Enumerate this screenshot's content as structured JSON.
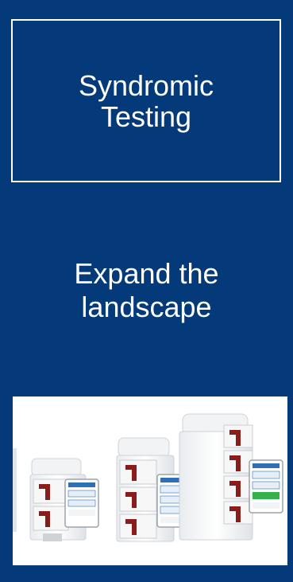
{
  "title_box": {
    "line1": "Syndromic",
    "line2": "Testing"
  },
  "tagline": {
    "line1": "Expand the",
    "line2": "landscape"
  },
  "image": {
    "alt": "Modular testing instruments with touchscreens"
  },
  "colors": {
    "background": "#043a79",
    "text": "#ffffff",
    "accent_red": "#8a1c1c",
    "screen_blue": "#2f6fb7",
    "screen_green": "#33b24a"
  }
}
